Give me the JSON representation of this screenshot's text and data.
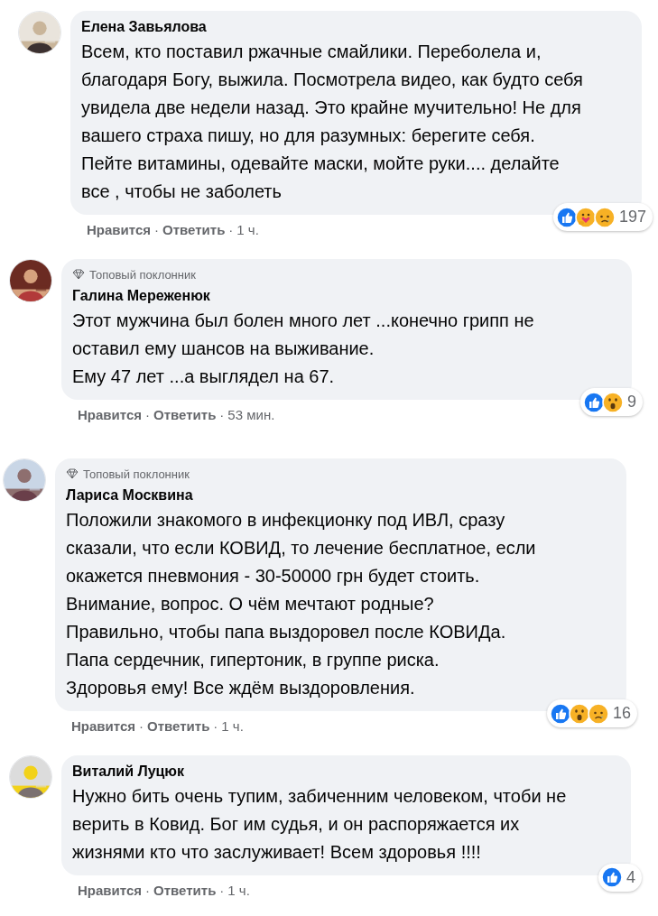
{
  "comments": [
    {
      "author": "Елена Завьялова",
      "text": "Всем, кто поставил ржачные смайлики. Переболела и, благодаря Богу, выжила. Посмотрела видео, как будто себя увидела две недели назад. Это крайне мучительно! Не для вашего страха пишу, но для разумных: берегите себя. Пейте витамины, одевайте маски, мойте руки.... делайте все , чтобы не заболеть",
      "reactions": [
        {
          "kind": "like"
        },
        {
          "kind": "care"
        },
        {
          "kind": "sad"
        }
      ],
      "reaction_count": "197",
      "like_label": "Нравится",
      "sep_1": "·",
      "reply_label": "Ответить",
      "sep_2": "·",
      "time": "1 ч."
    },
    {
      "badge": "Топовый поклонник",
      "author": "Галина Мереженюк",
      "text": "Этот мужчина был болен много лет ...конечно грипп не оставил ему шансов на выживание.\nЕму 47 лет ...а выглядел на 67.",
      "reactions": [
        {
          "kind": "like"
        },
        {
          "kind": "wow"
        }
      ],
      "reaction_count": "9",
      "like_label": "Нравится",
      "sep_1": "·",
      "reply_label": "Ответить",
      "sep_2": "·",
      "time": "53 мин."
    },
    {
      "badge": "Топовый поклонник",
      "author": "Лариса Москвина",
      "text": "Положили знакомого в инфекционку под ИВЛ, сразу сказали, что если КОВИД, то лечение бесплатное, если окажется пневмония - 30-50000 грн будет стоить.\nВнимание, вопрос. О чём мечтают родные?\nПравильно, чтобы папа выздоровел после КОВИДа.\nПапа сердечник, гипертоник, в группе риска.\nЗдоровья ему! Все ждём выздоровления.",
      "reactions": [
        {
          "kind": "like"
        },
        {
          "kind": "wow"
        },
        {
          "kind": "sad"
        }
      ],
      "reaction_count": "16",
      "like_label": "Нравится",
      "sep_1": "·",
      "reply_label": "Ответить",
      "sep_2": "·",
      "time": "1 ч."
    },
    {
      "author": "Виталий Луцюк",
      "text": "Нужно бить очень тупим, забиченним человеком, чтоби не верить в Ковид. Бог им судья, и он распоряжается их жизнями кто что заслуживает! Всем здоровья !!!!",
      "reactions": [
        {
          "kind": "like"
        }
      ],
      "reaction_count": "4",
      "like_label": "Нравится",
      "sep_1": "·",
      "reply_label": "Ответить",
      "sep_2": "·",
      "time": "1 ч."
    }
  ]
}
